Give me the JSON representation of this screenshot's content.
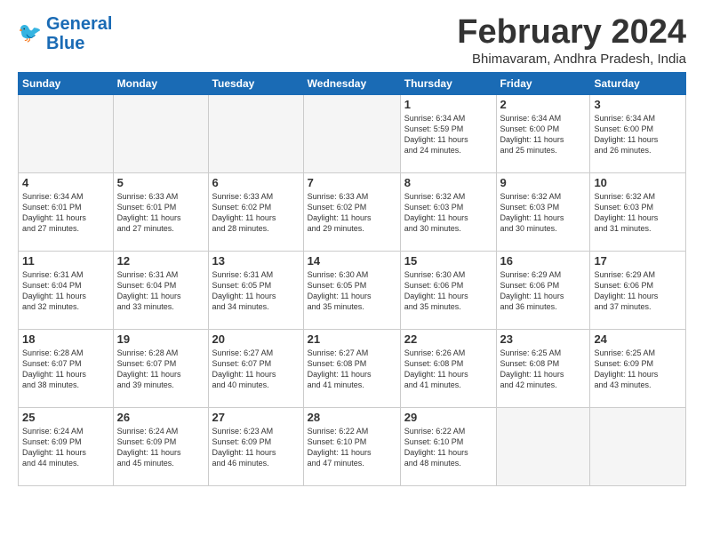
{
  "logo": {
    "line1": "General",
    "line2": "Blue"
  },
  "title": "February 2024",
  "location": "Bhimavaram, Andhra Pradesh, India",
  "days_of_week": [
    "Sunday",
    "Monday",
    "Tuesday",
    "Wednesday",
    "Thursday",
    "Friday",
    "Saturday"
  ],
  "weeks": [
    [
      {
        "day": "",
        "info": ""
      },
      {
        "day": "",
        "info": ""
      },
      {
        "day": "",
        "info": ""
      },
      {
        "day": "",
        "info": ""
      },
      {
        "day": "1",
        "info": "Sunrise: 6:34 AM\nSunset: 5:59 PM\nDaylight: 11 hours\nand 24 minutes."
      },
      {
        "day": "2",
        "info": "Sunrise: 6:34 AM\nSunset: 6:00 PM\nDaylight: 11 hours\nand 25 minutes."
      },
      {
        "day": "3",
        "info": "Sunrise: 6:34 AM\nSunset: 6:00 PM\nDaylight: 11 hours\nand 26 minutes."
      }
    ],
    [
      {
        "day": "4",
        "info": "Sunrise: 6:34 AM\nSunset: 6:01 PM\nDaylight: 11 hours\nand 27 minutes."
      },
      {
        "day": "5",
        "info": "Sunrise: 6:33 AM\nSunset: 6:01 PM\nDaylight: 11 hours\nand 27 minutes."
      },
      {
        "day": "6",
        "info": "Sunrise: 6:33 AM\nSunset: 6:02 PM\nDaylight: 11 hours\nand 28 minutes."
      },
      {
        "day": "7",
        "info": "Sunrise: 6:33 AM\nSunset: 6:02 PM\nDaylight: 11 hours\nand 29 minutes."
      },
      {
        "day": "8",
        "info": "Sunrise: 6:32 AM\nSunset: 6:03 PM\nDaylight: 11 hours\nand 30 minutes."
      },
      {
        "day": "9",
        "info": "Sunrise: 6:32 AM\nSunset: 6:03 PM\nDaylight: 11 hours\nand 30 minutes."
      },
      {
        "day": "10",
        "info": "Sunrise: 6:32 AM\nSunset: 6:03 PM\nDaylight: 11 hours\nand 31 minutes."
      }
    ],
    [
      {
        "day": "11",
        "info": "Sunrise: 6:31 AM\nSunset: 6:04 PM\nDaylight: 11 hours\nand 32 minutes."
      },
      {
        "day": "12",
        "info": "Sunrise: 6:31 AM\nSunset: 6:04 PM\nDaylight: 11 hours\nand 33 minutes."
      },
      {
        "day": "13",
        "info": "Sunrise: 6:31 AM\nSunset: 6:05 PM\nDaylight: 11 hours\nand 34 minutes."
      },
      {
        "day": "14",
        "info": "Sunrise: 6:30 AM\nSunset: 6:05 PM\nDaylight: 11 hours\nand 35 minutes."
      },
      {
        "day": "15",
        "info": "Sunrise: 6:30 AM\nSunset: 6:06 PM\nDaylight: 11 hours\nand 35 minutes."
      },
      {
        "day": "16",
        "info": "Sunrise: 6:29 AM\nSunset: 6:06 PM\nDaylight: 11 hours\nand 36 minutes."
      },
      {
        "day": "17",
        "info": "Sunrise: 6:29 AM\nSunset: 6:06 PM\nDaylight: 11 hours\nand 37 minutes."
      }
    ],
    [
      {
        "day": "18",
        "info": "Sunrise: 6:28 AM\nSunset: 6:07 PM\nDaylight: 11 hours\nand 38 minutes."
      },
      {
        "day": "19",
        "info": "Sunrise: 6:28 AM\nSunset: 6:07 PM\nDaylight: 11 hours\nand 39 minutes."
      },
      {
        "day": "20",
        "info": "Sunrise: 6:27 AM\nSunset: 6:07 PM\nDaylight: 11 hours\nand 40 minutes."
      },
      {
        "day": "21",
        "info": "Sunrise: 6:27 AM\nSunset: 6:08 PM\nDaylight: 11 hours\nand 41 minutes."
      },
      {
        "day": "22",
        "info": "Sunrise: 6:26 AM\nSunset: 6:08 PM\nDaylight: 11 hours\nand 41 minutes."
      },
      {
        "day": "23",
        "info": "Sunrise: 6:25 AM\nSunset: 6:08 PM\nDaylight: 11 hours\nand 42 minutes."
      },
      {
        "day": "24",
        "info": "Sunrise: 6:25 AM\nSunset: 6:09 PM\nDaylight: 11 hours\nand 43 minutes."
      }
    ],
    [
      {
        "day": "25",
        "info": "Sunrise: 6:24 AM\nSunset: 6:09 PM\nDaylight: 11 hours\nand 44 minutes."
      },
      {
        "day": "26",
        "info": "Sunrise: 6:24 AM\nSunset: 6:09 PM\nDaylight: 11 hours\nand 45 minutes."
      },
      {
        "day": "27",
        "info": "Sunrise: 6:23 AM\nSunset: 6:09 PM\nDaylight: 11 hours\nand 46 minutes."
      },
      {
        "day": "28",
        "info": "Sunrise: 6:22 AM\nSunset: 6:10 PM\nDaylight: 11 hours\nand 47 minutes."
      },
      {
        "day": "29",
        "info": "Sunrise: 6:22 AM\nSunset: 6:10 PM\nDaylight: 11 hours\nand 48 minutes."
      },
      {
        "day": "",
        "info": ""
      },
      {
        "day": "",
        "info": ""
      }
    ]
  ]
}
